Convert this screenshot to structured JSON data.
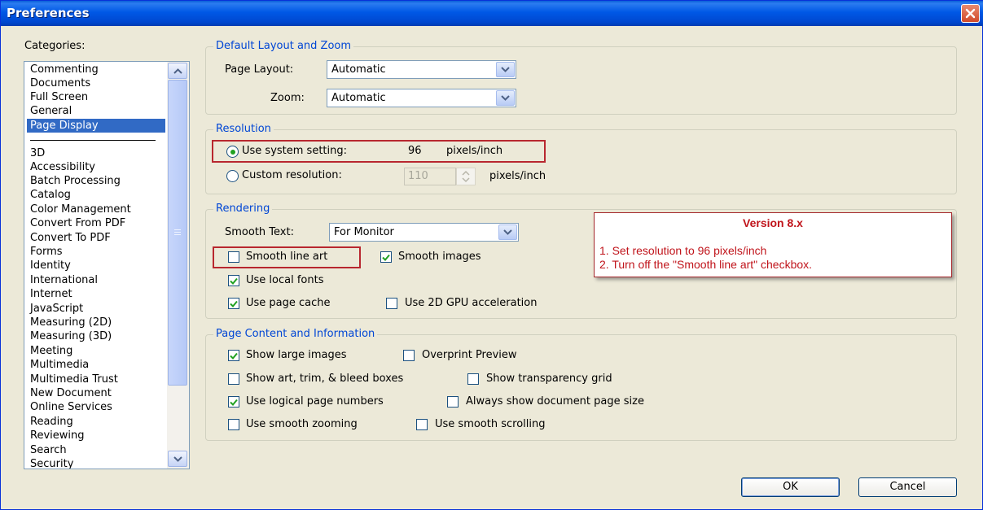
{
  "window": {
    "title": "Preferences"
  },
  "categories": {
    "label": "Categories:",
    "items": [
      "Commenting",
      "Documents",
      "Full Screen",
      "General",
      "Page Display",
      "3D",
      "Accessibility",
      "Batch Processing",
      "Catalog",
      "Color Management",
      "Convert From PDF",
      "Convert To PDF",
      "Forms",
      "Identity",
      "International",
      "Internet",
      "JavaScript",
      "Measuring (2D)",
      "Measuring (3D)",
      "Meeting",
      "Multimedia",
      "Multimedia Trust",
      "New Document",
      "Online Services",
      "Reading",
      "Reviewing",
      "Search",
      "Security"
    ],
    "selected": "Page Display"
  },
  "layout_zoom": {
    "legend": "Default Layout and Zoom",
    "page_layout_label": "Page Layout:",
    "page_layout_value": "Automatic",
    "zoom_label": "Zoom:",
    "zoom_value": "Automatic"
  },
  "resolution": {
    "legend": "Resolution",
    "system_label": "Use system setting:",
    "system_value": "96",
    "system_unit": "pixels/inch",
    "system_selected": true,
    "custom_label": "Custom resolution:",
    "custom_value": "110",
    "custom_unit": "pixels/inch",
    "custom_selected": false
  },
  "rendering": {
    "legend": "Rendering",
    "smooth_text_label": "Smooth Text:",
    "smooth_text_value": "For Monitor",
    "smooth_line_art": {
      "label": "Smooth line art",
      "checked": false
    },
    "smooth_images": {
      "label": "Smooth images",
      "checked": true
    },
    "local_fonts": {
      "label": "Use local fonts",
      "checked": true
    },
    "page_cache": {
      "label": "Use page cache",
      "checked": true
    },
    "gpu": {
      "label": "Use 2D GPU acceleration",
      "checked": false
    }
  },
  "page_content": {
    "legend": "Page Content and Information",
    "large_images": {
      "label": "Show large images",
      "checked": true
    },
    "overprint": {
      "label": "Overprint Preview",
      "checked": false
    },
    "art_trim": {
      "label": "Show art, trim, & bleed boxes",
      "checked": false
    },
    "transparency": {
      "label": "Show transparency grid",
      "checked": false
    },
    "logical_pages": {
      "label": "Use logical page numbers",
      "checked": true
    },
    "doc_page_size": {
      "label": "Always show document page size",
      "checked": false
    },
    "smooth_zoom": {
      "label": "Use smooth zooming",
      "checked": false
    },
    "smooth_scroll": {
      "label": "Use smooth scrolling",
      "checked": false
    }
  },
  "annotation": {
    "title": "Version 8.x",
    "line1": "1. Set resolution to 96 pixels/inch",
    "line2": "2. Turn off the \"Smooth line art\" checkbox."
  },
  "buttons": {
    "ok": "OK",
    "cancel": "Cancel"
  },
  "colors": {
    "accent": "#0046d5",
    "selection": "#316ac5",
    "highlight_red": "#b8272f",
    "title_bar": "#0058e6"
  }
}
